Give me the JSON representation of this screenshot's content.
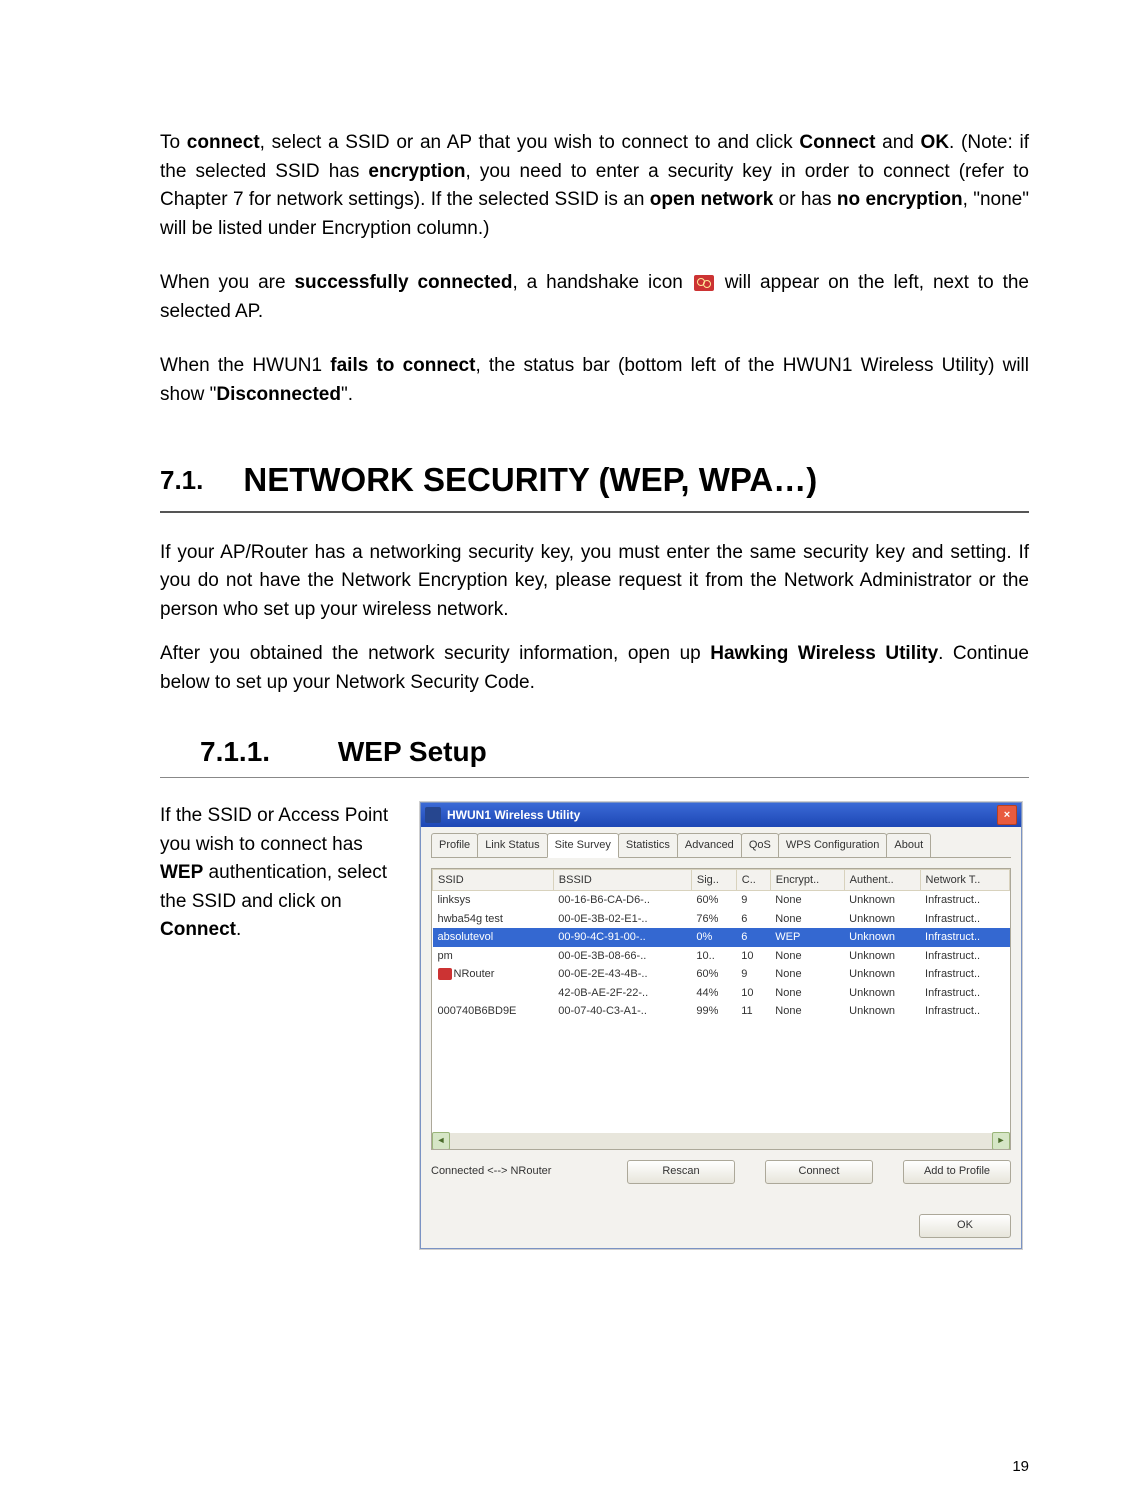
{
  "p1_a": "To ",
  "p1_b": "connect",
  "p1_c": ", select a SSID or an AP that you wish to connect to and click ",
  "p1_d": "Connect",
  "p1_e": " and ",
  "p1_f": "OK",
  "p1_g": ".  (Note: if the selected SSID has ",
  "p1_h": "encryption",
  "p1_i": ", you need to enter a security key in order to connect (refer to Chapter 7 for network settings). If the selected SSID is an ",
  "p1_j": "open network",
  "p1_k": " or has ",
  "p1_l": "no encryption",
  "p1_m": ", \"none\" will be listed under Encryption column.)",
  "p2_a": "When you are ",
  "p2_b": "successfully connected",
  "p2_c": ", a handshake icon ",
  "p2_d": " will appear on the left, next to the selected AP.",
  "p3_a": "When the HWUN1 ",
  "p3_b": "fails to connect",
  "p3_c": ", the status bar (bottom left of the HWUN1 Wireless Utility) will show \"",
  "p3_d": "Disconnected",
  "p3_e": "\".",
  "sec_num": "7.1.",
  "sec_title": "NETWORK SECURITY (WEP, WPA…)",
  "p4": "If your AP/Router has a networking security key, you must enter the same security key and setting.  If you do not have the Network Encryption key, please request it from the Network Administrator or the person who set up your wireless network.",
  "p5_a": "After you obtained the network security information, open up ",
  "p5_b": "Hawking Wireless Utility",
  "p5_c": ".  Continue below to set up your Network Security Code.",
  "sub_num": "7.1.1.",
  "sub_title": "WEP Setup",
  "left_a": "If the SSID or Access Point you wish to connect has ",
  "left_b": "WEP",
  "left_c": " authentication, select the SSID and click on ",
  "left_d": "Connect",
  "left_e": ".",
  "dlg": {
    "title": "HWUN1 Wireless Utility",
    "tabs": [
      "Profile",
      "Link Status",
      "Site Survey",
      "Statistics",
      "Advanced",
      "QoS",
      "WPS Configuration",
      "About"
    ],
    "cols": [
      "SSID",
      "BSSID",
      "Sig..",
      "C..",
      "Encrypt..",
      "Authent..",
      "Network T.."
    ],
    "rows": [
      {
        "ssid": "linksys",
        "bssid": "00-16-B6-CA-D6-..",
        "sig": "60%",
        "c": "9",
        "enc": "None",
        "auth": "Unknown",
        "net": "Infrastruct.."
      },
      {
        "ssid": "hwba54g test",
        "bssid": "00-0E-3B-02-E1-..",
        "sig": "76%",
        "c": "6",
        "enc": "None",
        "auth": "Unknown",
        "net": "Infrastruct.."
      },
      {
        "ssid": "absolutevol",
        "bssid": "00-90-4C-91-00-..",
        "sig": "0%",
        "c": "6",
        "enc": "WEP",
        "auth": "Unknown",
        "net": "Infrastruct..",
        "sel": true
      },
      {
        "ssid": "pm",
        "bssid": "00-0E-3B-08-66-..",
        "sig": "10..",
        "c": "10",
        "enc": "None",
        "auth": "Unknown",
        "net": "Infrastruct.."
      },
      {
        "ssid": "NRouter",
        "bssid": "00-0E-2E-43-4B-..",
        "sig": "60%",
        "c": "9",
        "enc": "None",
        "auth": "Unknown",
        "net": "Infrastruct..",
        "hs": true
      },
      {
        "ssid": "",
        "bssid": "42-0B-AE-2F-22-..",
        "sig": "44%",
        "c": "10",
        "enc": "None",
        "auth": "Unknown",
        "net": "Infrastruct.."
      },
      {
        "ssid": "000740B6BD9E",
        "bssid": "00-07-40-C3-A1-..",
        "sig": "99%",
        "c": "11",
        "enc": "None",
        "auth": "Unknown",
        "net": "Infrastruct.."
      }
    ],
    "status": "Connected <--> NRouter",
    "btn_rescan": "Rescan",
    "btn_connect": "Connect",
    "btn_addprofile": "Add to Profile",
    "btn_ok": "OK"
  },
  "pagenum": "19"
}
